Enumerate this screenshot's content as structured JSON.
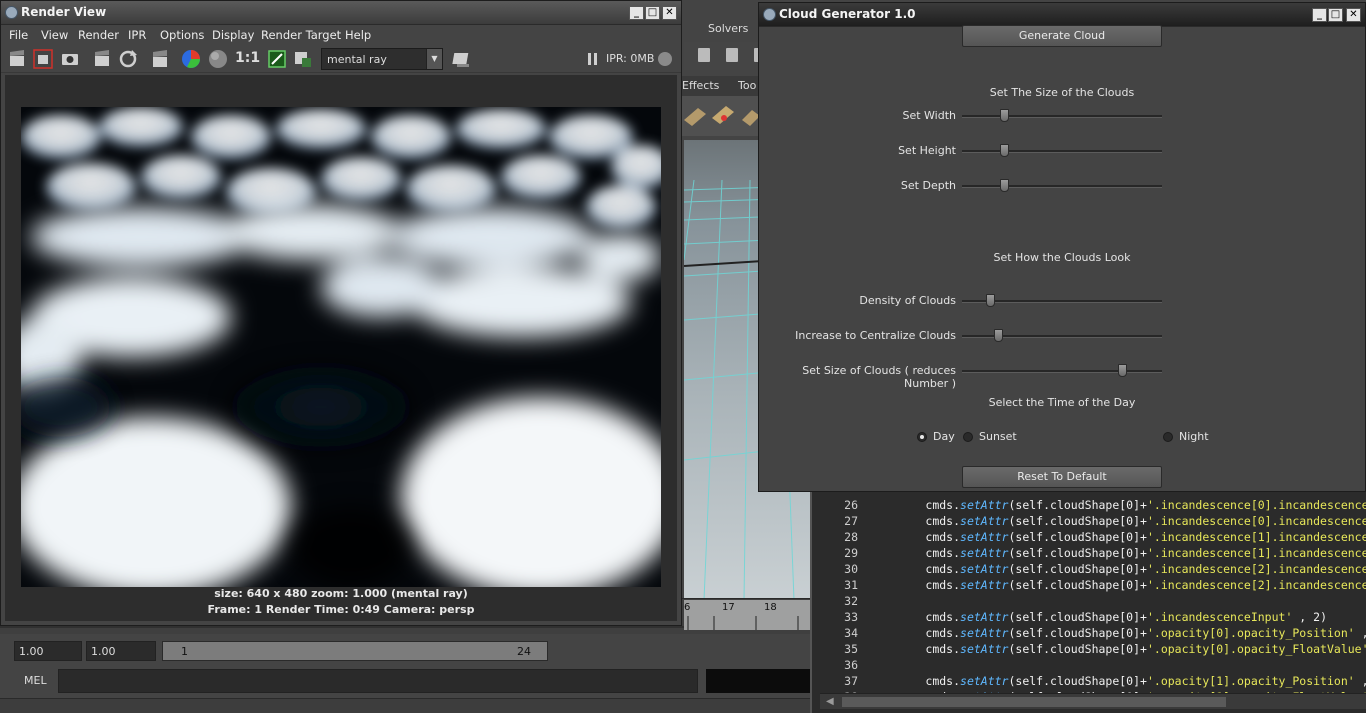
{
  "background": {
    "menubar": {
      "solvers": "Solvers"
    },
    "tabs": {
      "effects": "Effects",
      "toolkit_partial": "Too"
    },
    "ruler": {
      "n6": "6",
      "n17": "17",
      "n18": "18"
    },
    "range": {
      "start_field": "1.00",
      "current_field": "1.00",
      "slider_start": "1",
      "slider_end": "24"
    },
    "mel_label": "MEL"
  },
  "script_editor": {
    "lines": [
      {
        "num": "26",
        "indent": "        ",
        "pre": "cmds.",
        "fn": "setAttr",
        "mid": "(self.cloudShape[0]+",
        "str": "'.incandescence[0].incandescence",
        "post": ""
      },
      {
        "num": "27",
        "indent": "        ",
        "pre": "cmds.",
        "fn": "setAttr",
        "mid": "(self.cloudShape[0]+",
        "str": "'.incandescence[0].incandescence",
        "post": ""
      },
      {
        "num": "28",
        "indent": "        ",
        "pre": "cmds.",
        "fn": "setAttr",
        "mid": "(self.cloudShape[0]+",
        "str": "'.incandescence[1].incandescence",
        "post": ""
      },
      {
        "num": "29",
        "indent": "        ",
        "pre": "cmds.",
        "fn": "setAttr",
        "mid": "(self.cloudShape[0]+",
        "str": "'.incandescence[1].incandescence",
        "post": ""
      },
      {
        "num": "30",
        "indent": "        ",
        "pre": "cmds.",
        "fn": "setAttr",
        "mid": "(self.cloudShape[0]+",
        "str": "'.incandescence[2].incandescence",
        "post": ""
      },
      {
        "num": "31",
        "indent": "        ",
        "pre": "cmds.",
        "fn": "setAttr",
        "mid": "(self.cloudShape[0]+",
        "str": "'.incandescence[2].incandescence",
        "post": ""
      },
      {
        "num": "32",
        "indent": "",
        "pre": "",
        "fn": "",
        "mid": "",
        "str": "",
        "post": ""
      },
      {
        "num": "33",
        "indent": "        ",
        "pre": "cmds.",
        "fn": "setAttr",
        "mid": "(self.cloudShape[0]+",
        "str": "'.incandescenceInput'",
        "post": " , 2)"
      },
      {
        "num": "34",
        "indent": "        ",
        "pre": "cmds.",
        "fn": "setAttr",
        "mid": "(self.cloudShape[0]+",
        "str": "'.opacity[0].opacity_Position'",
        "post": " ,"
      },
      {
        "num": "35",
        "indent": "        ",
        "pre": "cmds.",
        "fn": "setAttr",
        "mid": "(self.cloudShape[0]+",
        "str": "'.opacity[0].opacity_FloatValue'",
        "post": " ,"
      },
      {
        "num": "36",
        "indent": "",
        "pre": "",
        "fn": "",
        "mid": "",
        "str": "",
        "post": ""
      },
      {
        "num": "37",
        "indent": "        ",
        "pre": "cmds.",
        "fn": "setAttr",
        "mid": "(self.cloudShape[0]+",
        "str": "'.opacity[1].opacity_Position'",
        "post": " ,"
      },
      {
        "num": "38",
        "indent": "        ",
        "pre": "cmds.",
        "fn": "setAttr",
        "mid": "(self.cloudShape[0]+",
        "str": "'.opacity[1].opacity_FloatValue'",
        "post": " ,"
      }
    ]
  },
  "render_view": {
    "title": "Render View",
    "menu": [
      "File",
      "View",
      "Render",
      "IPR",
      "Options",
      "Display",
      "Render Target",
      "Help"
    ],
    "renderer": "mental ray",
    "ratio_label": "1:1",
    "ipr_status": "IPR: 0MB",
    "info_line1": "size: 640 x 480 zoom: 1.000      (mental ray)",
    "info_line2": "Frame: 1       Render Time: 0:49       Camera: persp",
    "icons": [
      "clapper-icon",
      "render-region-icon",
      "snapshot-icon",
      "ipr-clapper-icon",
      "refresh-icon",
      "batch-clapper-icon",
      "color-wheel-icon",
      "grey-sphere-icon",
      "frame-region-icon",
      "keep-image-icon",
      "render-settings-icon",
      "pause-icon",
      "ipr-indicator-icon"
    ]
  },
  "cloud_generator": {
    "title": "Cloud Generator 1.0",
    "generate_button": "Generate Cloud",
    "size_heading": "Set The Size of the Clouds",
    "look_heading": "Set How the Clouds Look",
    "time_heading": "Select the Time of the Day",
    "reset_button": "Reset To Default",
    "sliders": [
      {
        "label": "Set Width",
        "value": 0.21
      },
      {
        "label": "Set Height",
        "value": 0.21
      },
      {
        "label": "Set Depth",
        "value": 0.21
      },
      {
        "label": "Density of Clouds",
        "value": 0.14
      },
      {
        "label": "Increase to Centralize Clouds",
        "value": 0.18
      },
      {
        "label": "Set Size of Clouds ( reduces Number )",
        "value": 0.8
      }
    ],
    "time_options": [
      {
        "label": "Day",
        "selected": true
      },
      {
        "label": "Sunset",
        "selected": false
      },
      {
        "label": "Night",
        "selected": false
      }
    ]
  }
}
